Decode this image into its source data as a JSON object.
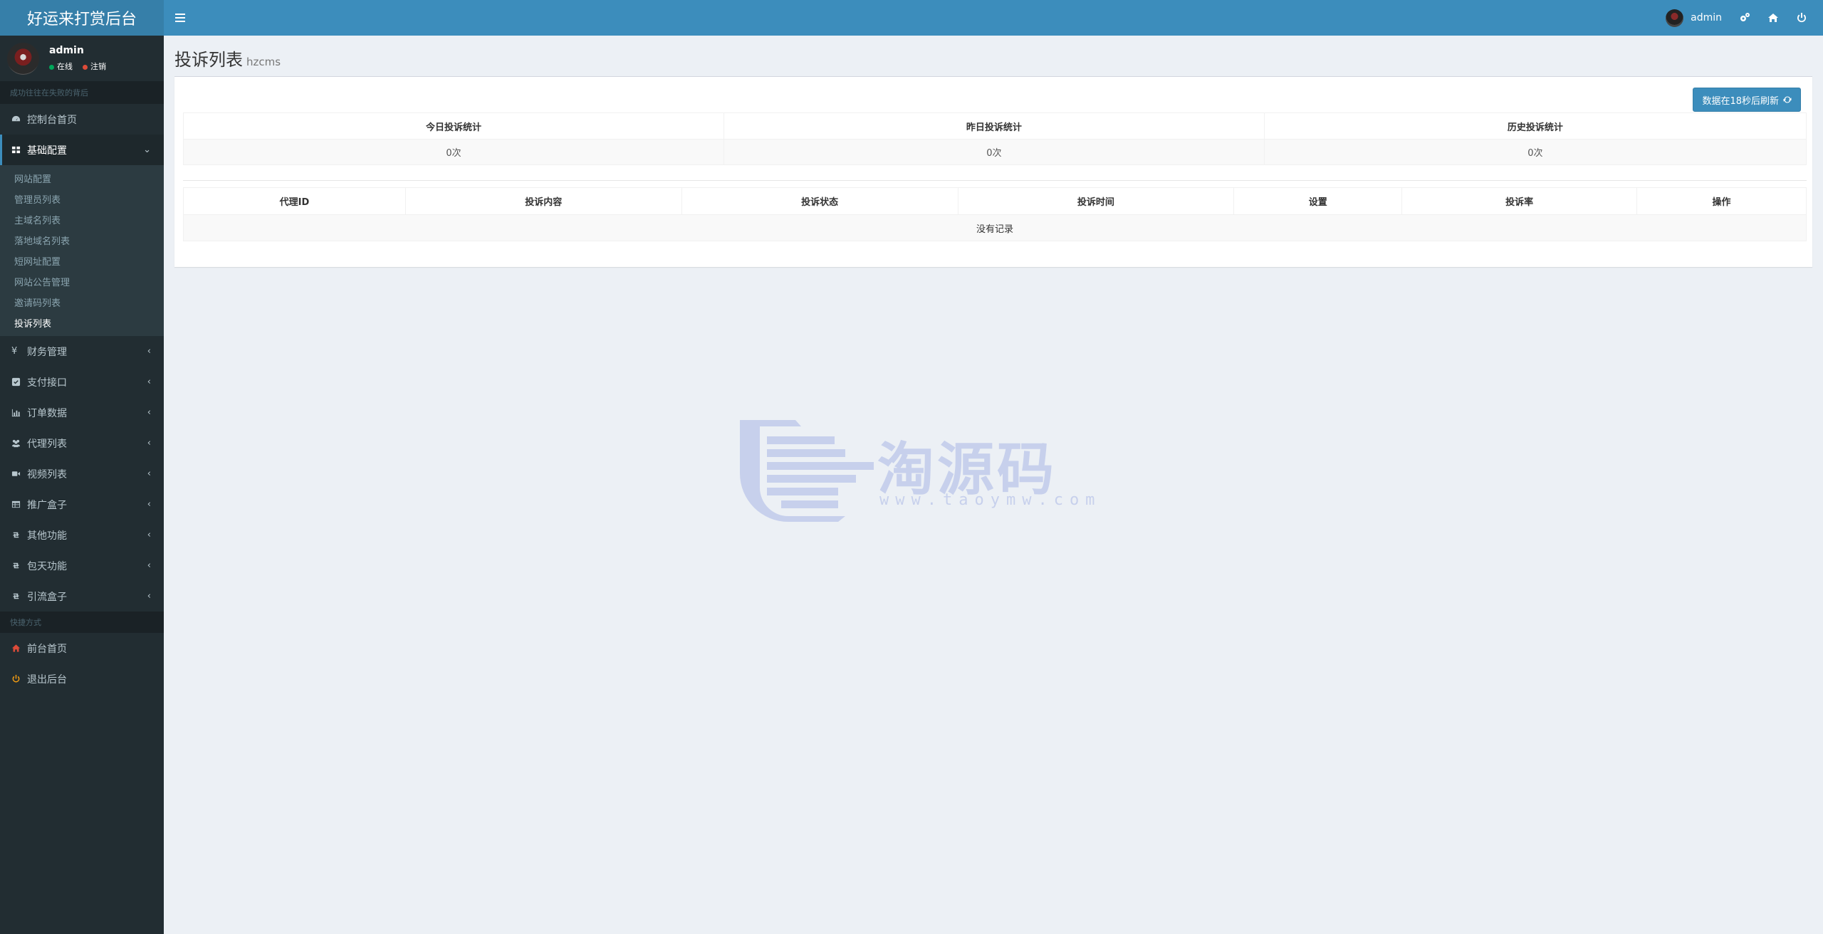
{
  "app": {
    "title": "好运来打赏后台"
  },
  "header": {
    "user_name": "admin"
  },
  "sidebar": {
    "user": {
      "name": "admin",
      "status_online": "在线",
      "status_logout": "注销"
    },
    "search_text": "成功往往在失败的背后",
    "menu": [
      {
        "label": "控制台首页",
        "icon": "dashboard-icon"
      },
      {
        "label": "基础配置",
        "icon": "grid-icon"
      },
      {
        "label": "财务管理",
        "icon": "yen-icon"
      },
      {
        "label": "支付接口",
        "icon": "payment-icon"
      },
      {
        "label": "订单数据",
        "icon": "bar-chart-icon"
      },
      {
        "label": "代理列表",
        "icon": "users-icon"
      },
      {
        "label": "视频列表",
        "icon": "video-icon"
      },
      {
        "label": "推广盒子",
        "icon": "table-icon"
      },
      {
        "label": "其他功能",
        "icon": "retweet-icon"
      },
      {
        "label": "包天功能",
        "icon": "retweet-icon"
      },
      {
        "label": "引流盒子",
        "icon": "retweet-icon"
      }
    ],
    "submenu": [
      {
        "label": "网站配置"
      },
      {
        "label": "管理员列表"
      },
      {
        "label": "主域名列表"
      },
      {
        "label": "落地域名列表"
      },
      {
        "label": "短网址配置"
      },
      {
        "label": "网站公告管理"
      },
      {
        "label": "邀请码列表"
      },
      {
        "label": "投诉列表"
      }
    ],
    "shortcut_header": "快捷方式",
    "shortcuts": [
      {
        "label": "前台首页",
        "icon": "home-icon",
        "color": "#dd4b39"
      },
      {
        "label": "退出后台",
        "icon": "power-icon",
        "color": "#f39c12"
      }
    ]
  },
  "page": {
    "title": "投诉列表",
    "subtitle": "hzcms",
    "refresh_label": "数据在18秒后刷新"
  },
  "stats": {
    "headers": [
      "今日投诉统计",
      "昨日投诉统计",
      "历史投诉统计"
    ],
    "values": [
      "0次",
      "0次",
      "0次"
    ]
  },
  "list": {
    "headers": [
      "代理ID",
      "投诉内容",
      "投诉状态",
      "投诉时间",
      "设置",
      "投诉率",
      "操作"
    ],
    "empty_text": "没有记录"
  },
  "watermark": {
    "text": "淘源码",
    "url": "www.taoymw.com"
  },
  "colors": {
    "header": "#3c8dbc",
    "logo": "#367fa9",
    "sidebar": "#222d32"
  }
}
